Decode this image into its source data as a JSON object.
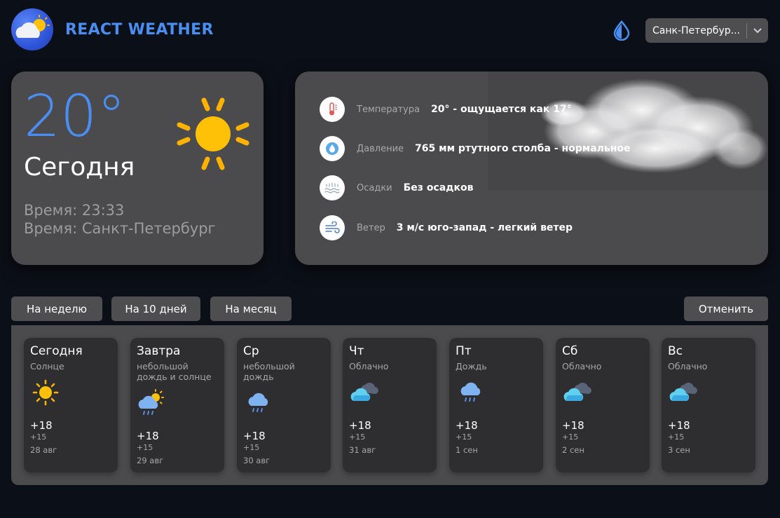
{
  "header": {
    "title": "REACT WEATHER",
    "logo_icon": "cloud-sun-logo-icon",
    "theme_icon": "drop-icon",
    "city_selected": "Санк-Петербур...",
    "accent": "#4a8ef2"
  },
  "today": {
    "temp": "20°",
    "label": "Сегодня",
    "time": "Время: 23:33",
    "city": "Время: Санкт-Петербург",
    "icon": "sun-icon"
  },
  "details": {
    "rows": [
      {
        "icon": "thermometer-icon",
        "label": "Температура",
        "value": "20° - ощущается как 17°"
      },
      {
        "icon": "pressure-icon",
        "label": "Давление",
        "value": "765 мм ртутного столба - нормальное"
      },
      {
        "icon": "precipitation-icon",
        "label": "Осадки",
        "value": "Без осадков"
      },
      {
        "icon": "wind-icon",
        "label": "Ветер",
        "value": "3 м/с юго-запад - легкий ветер"
      }
    ]
  },
  "tabs": {
    "week": "На неделю",
    "ten_days": "На 10 дней",
    "month": "На месяц",
    "cancel": "Отменить"
  },
  "forecast": [
    {
      "day": "Сегодня",
      "cond": "Солнце",
      "icon": "sun-icon",
      "max": "+18",
      "min": "+15",
      "date": "28 авг"
    },
    {
      "day": "Завтра",
      "cond": "небольшой дождь и солнце",
      "icon": "sun-rain-icon",
      "max": "+18",
      "min": "+15",
      "date": "29 авг"
    },
    {
      "day": "Ср",
      "cond": "небольшой дождь",
      "icon": "rain-icon",
      "max": "+18",
      "min": "+15",
      "date": "30 авг"
    },
    {
      "day": "Чт",
      "cond": "Облачно",
      "icon": "cloudy-icon",
      "max": "+18",
      "min": "+15",
      "date": "31 авг"
    },
    {
      "day": "Пт",
      "cond": "Дождь",
      "icon": "rain-icon",
      "max": "+18",
      "min": "+15",
      "date": "1 сен"
    },
    {
      "day": "Сб",
      "cond": "Облачно",
      "icon": "cloudy-icon",
      "max": "+18",
      "min": "+15",
      "date": "2 сен"
    },
    {
      "day": "Вс",
      "cond": "Облачно",
      "icon": "cloudy-icon",
      "max": "+18",
      "min": "+15",
      "date": "3 сен"
    }
  ]
}
